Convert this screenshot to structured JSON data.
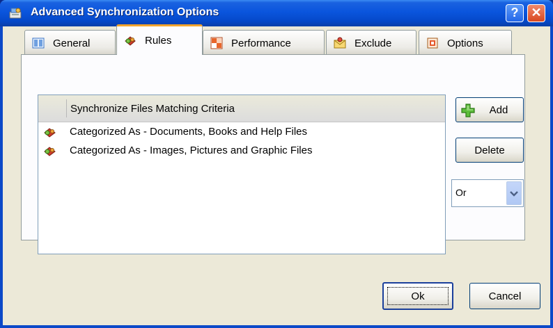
{
  "window": {
    "title": "Advanced Synchronization Options",
    "help_glyph": "?",
    "close_glyph": "✕"
  },
  "tabs": [
    {
      "label": "General",
      "icon": "general-tab-icon",
      "active": false
    },
    {
      "label": "Rules",
      "icon": "rules-tab-icon",
      "active": true
    },
    {
      "label": "Performance",
      "icon": "performance-tab-icon",
      "active": false
    },
    {
      "label": "Exclude",
      "icon": "exclude-tab-icon",
      "active": false
    },
    {
      "label": "Options",
      "icon": "options-tab-icon",
      "active": false
    }
  ],
  "rules": {
    "column_header": "Synchronize Files Matching Criteria",
    "items": [
      {
        "label": "Categorized As - Documents, Books and Help Files",
        "icon": "rule-icon"
      },
      {
        "label": "Categorized As - Images, Pictures and Graphic Files",
        "icon": "rule-icon"
      }
    ]
  },
  "side": {
    "add_label": "Add",
    "delete_label": "Delete",
    "operator_value": "Or"
  },
  "footer": {
    "ok_label": "Ok",
    "cancel_label": "Cancel"
  },
  "colors": {
    "title_blue": "#0a55dd",
    "client_bg": "#ece9d8",
    "active_tab_accent": "#f3a42d",
    "close_red": "#d9481f"
  }
}
